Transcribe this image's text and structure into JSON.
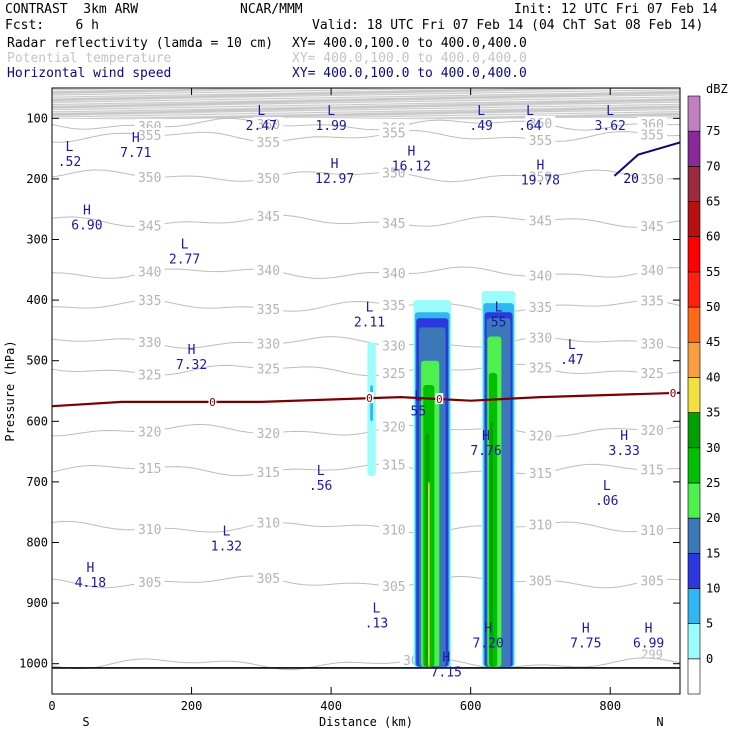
{
  "header": {
    "left1": "CONTRAST  3km ARW",
    "left2": "Fcst:    6 h",
    "center1": "NCAR/MMM",
    "right1": "Init: 12 UTC Fri 07 Feb 14",
    "right2": "Valid: 18 UTC Fri 07 Feb 14 (04 ChT Sat 08 Feb 14)",
    "fields": [
      {
        "label": "Radar reflectivity (lamda = 10 cm)",
        "xy": "XY= 400.0,100.0 to 400.0,400.0",
        "style": "black"
      },
      {
        "label": "Potential temperature",
        "xy": "XY= 400.0,100.0 to 400.0,400.0",
        "style": "gray"
      },
      {
        "label": "Horizontal wind speed",
        "xy": "XY= 400.0,100.0 to 400.0,400.0",
        "style": "blue"
      }
    ]
  },
  "chart_data": {
    "type": "heatmap",
    "xlabel": "Distance (km)",
    "ylabel": "Pressure (hPa)",
    "x_end_labels": [
      "S",
      "N"
    ],
    "xlim": [
      0,
      900
    ],
    "ylim": [
      1050,
      50
    ],
    "x_ticks": [
      0,
      200,
      400,
      600,
      800
    ],
    "y_ticks": [
      100,
      200,
      300,
      400,
      500,
      600,
      700,
      800,
      900,
      1000
    ],
    "colorbar": {
      "unit": "dBZ",
      "levels": [
        0,
        5,
        10,
        15,
        20,
        25,
        30,
        35,
        40,
        45,
        50,
        55,
        60,
        65,
        70,
        75
      ],
      "colors": [
        "#ffffff",
        "#9bfcfc",
        "#30b6f0",
        "#2b38e0",
        "#3a78b8",
        "#4ef04e",
        "#00c000",
        "#00a000",
        "#f0e040",
        "#f8a040",
        "#ff6a1a",
        "#ff2010",
        "#ff0000",
        "#b81010",
        "#9a2a40",
        "#8a2a98",
        "#c080c0"
      ]
    },
    "theta_contours": [
      {
        "label": "360",
        "p": 110
      },
      {
        "label": "355",
        "p": 130
      },
      {
        "label": "350",
        "p": 195
      },
      {
        "label": "345",
        "p": 270
      },
      {
        "label": "340",
        "p": 355
      },
      {
        "label": "335",
        "p": 410
      },
      {
        "label": "330",
        "p": 470
      },
      {
        "label": "325",
        "p": 515
      },
      {
        "label": "320",
        "p": 615
      },
      {
        "label": "315",
        "p": 680
      },
      {
        "label": "310",
        "p": 775
      },
      {
        "label": "305",
        "p": 865
      },
      {
        "label": "300",
        "p": 1000
      },
      {
        "label": "299",
        "p": 985
      }
    ],
    "freezing_level": {
      "label": "0",
      "x": [
        0,
        100,
        300,
        500,
        600,
        700,
        900
      ],
      "p": [
        575,
        568,
        568,
        560,
        566,
        560,
        553
      ]
    },
    "wind_contour": {
      "label": "20",
      "x": [
        806,
        840,
        900
      ],
      "p": [
        195,
        160,
        140
      ]
    },
    "hl_labels": [
      {
        "t": "L",
        "v": "2.47",
        "x": 300,
        "p": 98
      },
      {
        "t": "L",
        "v": "1.99",
        "x": 400,
        "p": 98
      },
      {
        "t": "L",
        "v": ".49",
        "x": 615,
        "p": 98
      },
      {
        "t": "L",
        "v": ".64",
        "x": 685,
        "p": 98
      },
      {
        "t": "L",
        "v": "3.62",
        "x": 800,
        "p": 98
      },
      {
        "t": "L",
        "v": ".52",
        "x": 25,
        "p": 157
      },
      {
        "t": "H",
        "v": "7.71",
        "x": 120,
        "p": 142
      },
      {
        "t": "H",
        "v": "12.97",
        "x": 405,
        "p": 185
      },
      {
        "t": "H",
        "v": "16.12",
        "x": 515,
        "p": 165
      },
      {
        "t": "H",
        "v": "19.78",
        "x": 700,
        "p": 188
      },
      {
        "t": "H",
        "v": "6.90",
        "x": 50,
        "p": 262
      },
      {
        "t": "L",
        "v": "2.77",
        "x": 190,
        "p": 318
      },
      {
        "t": "L",
        "v": "2.11",
        "x": 455,
        "p": 422
      },
      {
        "t": "L",
        "v": "55",
        "x": 640,
        "p": 422
      },
      {
        "t": "H",
        "v": "7.32",
        "x": 200,
        "p": 492
      },
      {
        "t": "L",
        "v": ".47",
        "x": 745,
        "p": 484
      },
      {
        "t": "L",
        "v": "55",
        "x": 525,
        "p": 569
      },
      {
        "t": "H",
        "v": "7.76",
        "x": 622,
        "p": 634
      },
      {
        "t": "H",
        "v": "3.33",
        "x": 820,
        "p": 634
      },
      {
        "t": "L",
        "v": ".56",
        "x": 385,
        "p": 692
      },
      {
        "t": "L",
        "v": ".06",
        "x": 795,
        "p": 717
      },
      {
        "t": "L",
        "v": "1.32",
        "x": 250,
        "p": 792
      },
      {
        "t": "H",
        "v": "4.18",
        "x": 55,
        "p": 852
      },
      {
        "t": "L",
        "v": ".13",
        "x": 465,
        "p": 919
      },
      {
        "t": "H",
        "v": "7.20",
        "x": 625,
        "p": 952
      },
      {
        "t": "H",
        "v": "7.75",
        "x": 765,
        "p": 952
      },
      {
        "t": "H",
        "v": "6.99",
        "x": 855,
        "p": 952
      },
      {
        "t": "H",
        "v": "7.15",
        "x": 565,
        "p": 1000
      }
    ]
  }
}
